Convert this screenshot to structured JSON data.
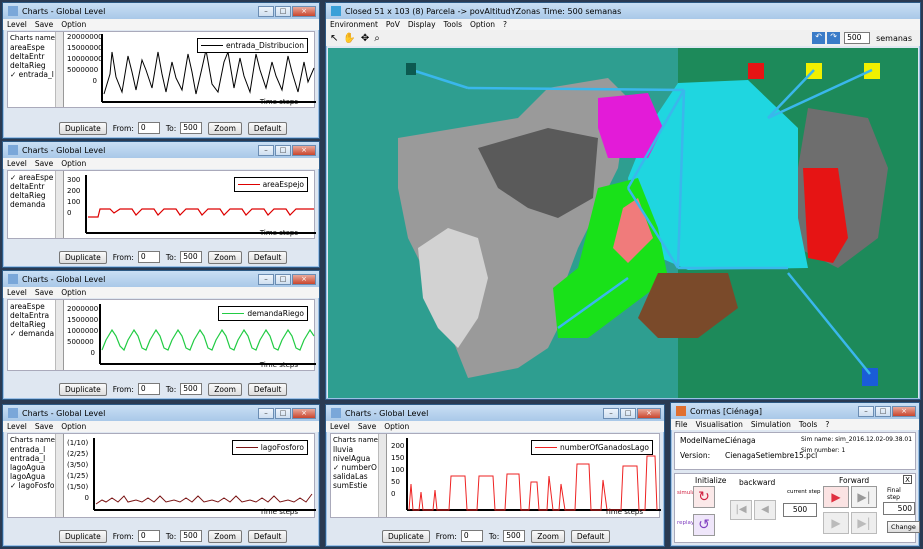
{
  "charts": [
    {
      "title": "Charts - Global Level",
      "menu": [
        "Level",
        "Save",
        "Option"
      ],
      "names_header": "Charts names",
      "names": [
        "areaEspe",
        "deltaEntr",
        "deltaRieg",
        "entrada_l"
      ],
      "checked": 3,
      "legend": "entrada_Distribucion",
      "color": "#000000",
      "ticks": [
        "20000000",
        "15000000",
        "10000000",
        "5000000",
        "0"
      ],
      "xlabel": "Time steps",
      "from": "0",
      "to": "500",
      "buttons": [
        "Duplicate",
        "Zoom",
        "Default"
      ],
      "from_label": "From:",
      "to_label": "To:"
    },
    {
      "title": "Charts - Global Level",
      "menu": [
        "Level",
        "Save",
        "Option"
      ],
      "names_header": "",
      "names": [
        "areaEspe",
        "deltaEntr",
        "deltaRieg",
        "demanda"
      ],
      "checked": 0,
      "legend": "areaEspejo",
      "color": "#dd0000",
      "ticks": [
        "300",
        "200",
        "100",
        "0"
      ],
      "xlabel": "Time steps",
      "from": "0",
      "to": "500",
      "buttons": [
        "Duplicate",
        "Zoom",
        "Default"
      ],
      "from_label": "From:",
      "to_label": "To:"
    },
    {
      "title": "Charts - Global Level",
      "menu": [
        "Level",
        "Save",
        "Option"
      ],
      "names_header": "",
      "names": [
        "areaEspe",
        "deltaEntra",
        "deltaRieg",
        "demanda"
      ],
      "checked": 3,
      "legend": "demandaRiego",
      "color": "#22cc44",
      "ticks": [
        "2000000",
        "1500000",
        "1000000",
        "500000",
        "0"
      ],
      "xlabel": "Time steps",
      "from": "0",
      "to": "500",
      "buttons": [
        "Duplicate",
        "Zoom",
        "Default"
      ],
      "from_label": "From:",
      "to_label": "To:"
    },
    {
      "title": "Charts - Global Level",
      "menu": [
        "Level",
        "Save",
        "Option"
      ],
      "names_header": "Charts names",
      "names": [
        "entrada_l",
        "entrada_l",
        "lagoAgua",
        "lagoAgua",
        "lagoFosfo"
      ],
      "checked": 4,
      "legend": "lagoFosforo",
      "color": "#7a1414",
      "ticks": [
        "(1/10)",
        "(2/25)",
        "(3/50)",
        "(1/25)",
        "(1/50)",
        "0"
      ],
      "xlabel": "Time steps",
      "from": "0",
      "to": "500",
      "buttons": [
        "Duplicate",
        "Zoom",
        "Default"
      ],
      "from_label": "From:",
      "to_label": "To:"
    },
    {
      "title": "Charts - Global Level",
      "menu": [
        "Level",
        "Save",
        "Option"
      ],
      "names_header": "Charts names",
      "names": [
        "lluvia",
        "nivelAgua",
        "numberO",
        "salidaLas",
        "sumEstie"
      ],
      "checked": 2,
      "legend": "numberOfGanadosLago",
      "color": "#ee2222",
      "ticks": [
        "200",
        "150",
        "100",
        "50",
        "0"
      ],
      "xlabel": "Time steps",
      "from": "0",
      "to": "500",
      "buttons": [
        "Duplicate",
        "Zoom",
        "Default"
      ],
      "from_label": "From:",
      "to_label": "To:"
    }
  ],
  "map": {
    "title": "Closed 51 x 103 (8)  Parcela -> povAltitudYZonas  Time: 500 semanas",
    "menu": [
      "Environment",
      "PoV",
      "Display",
      "Tools",
      "Option",
      "?"
    ],
    "steps": "500",
    "steps_unit": "semanas"
  },
  "cormas": {
    "title": "Cormas [Ciénaga]",
    "menu": [
      "File",
      "Visualisation",
      "Simulation",
      "Tools",
      "?"
    ],
    "model_label": "ModelName:",
    "model": "Ciénaga",
    "version_label": "Version:",
    "version": "CienagaSetiembre15.pcl",
    "sim_name": "Sim name: sim_2016.12.02-09.38.01",
    "sim_number": "Sim number: 1",
    "initialize": "Initialize",
    "backward": "backward",
    "forward": "Forward",
    "current_step_label": "current step",
    "current_step": "500",
    "final_step_label": "Final step",
    "final_step": "500",
    "change": "Change",
    "simulate": "simulate",
    "replay": "replay",
    "close": "X"
  }
}
